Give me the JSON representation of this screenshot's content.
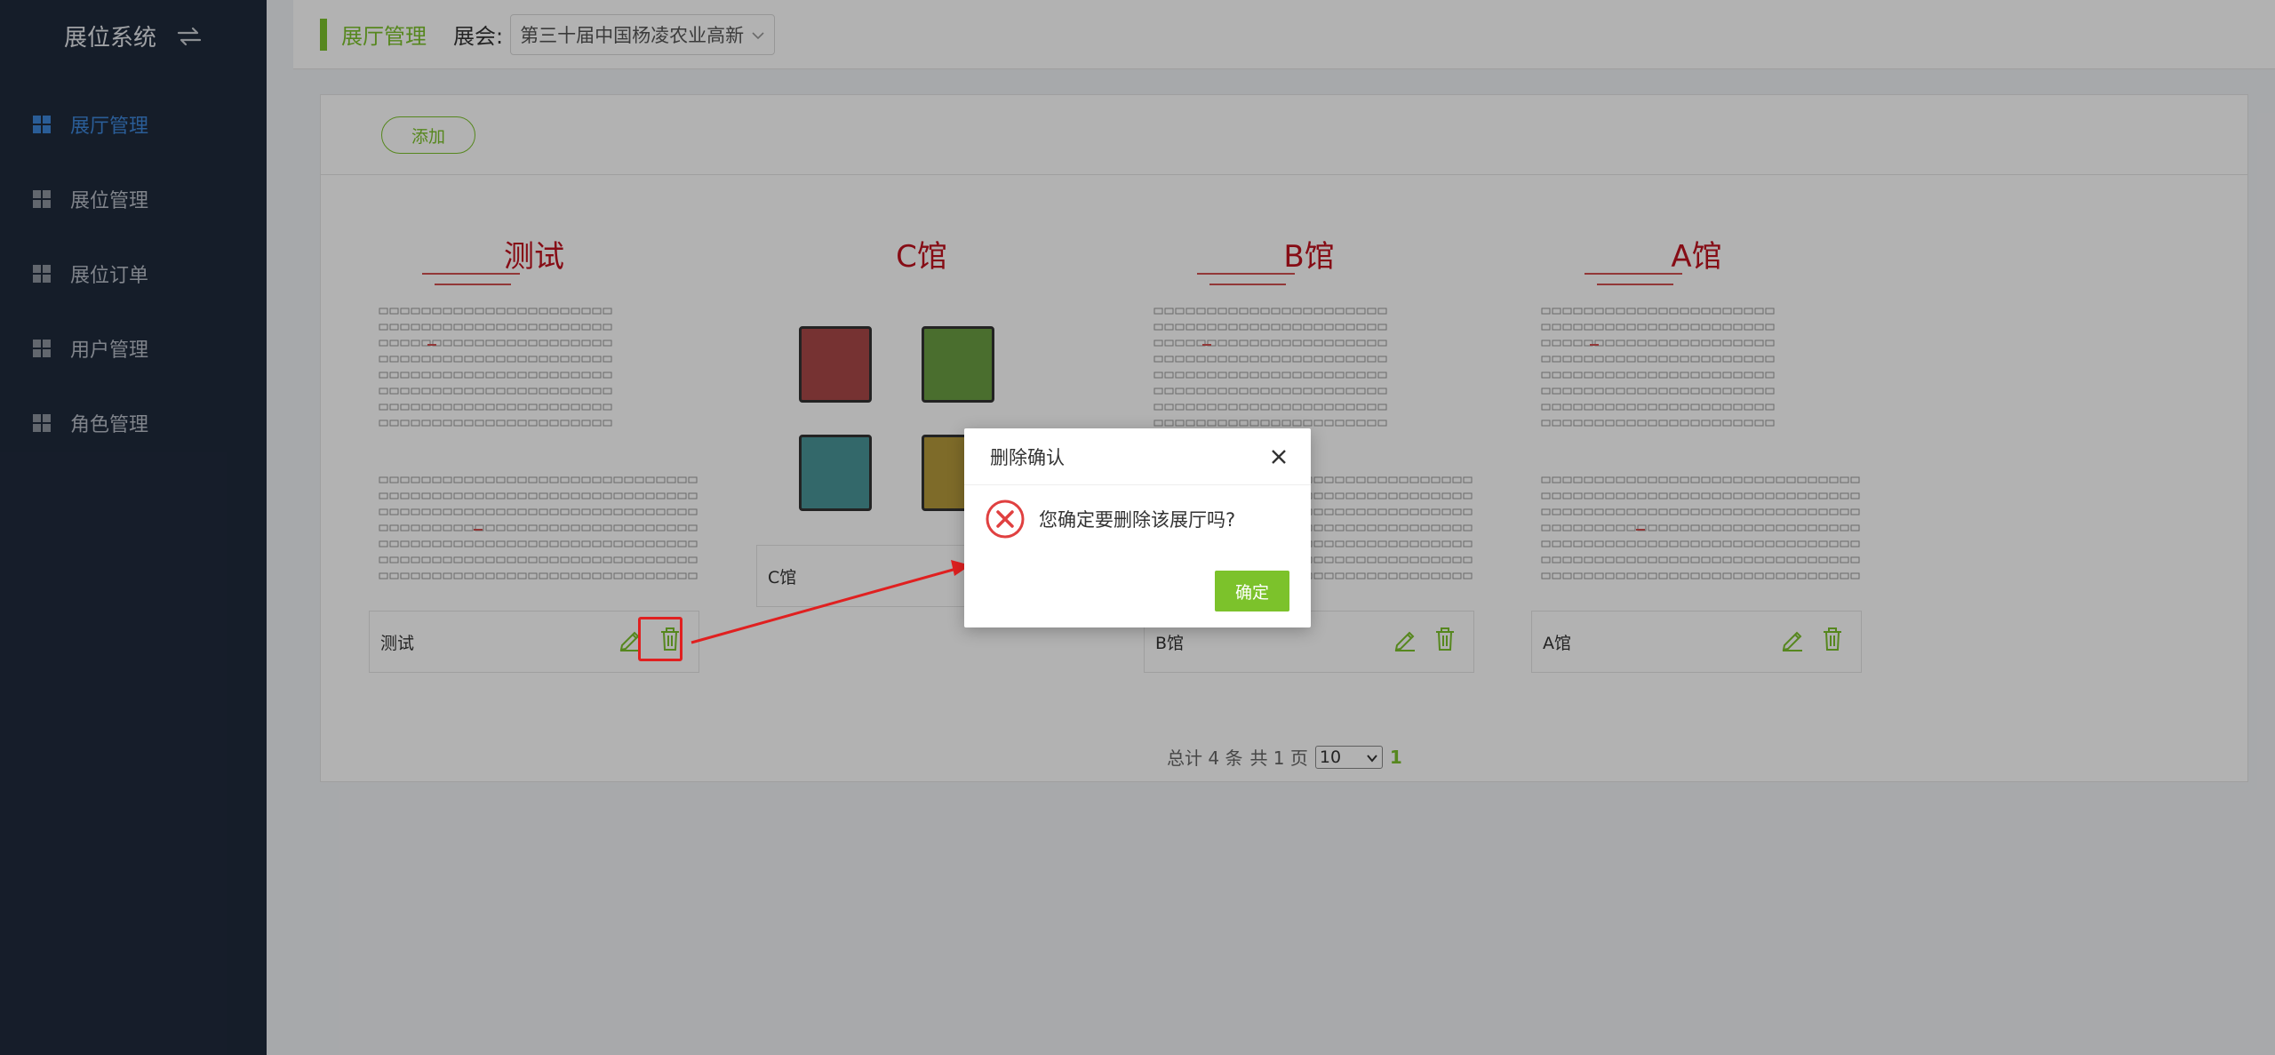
{
  "sidebar": {
    "brand": "展位系统",
    "items": [
      {
        "label": "展厅管理",
        "active": true
      },
      {
        "label": "展位管理"
      },
      {
        "label": "展位订单"
      },
      {
        "label": "用户管理"
      },
      {
        "label": "角色管理"
      }
    ]
  },
  "topbar": {
    "crumb": "展厅管理",
    "expo_label": "展会:",
    "expo_value": "第三十届中国杨凌农业高新"
  },
  "toolbar": {
    "add_label": "添加"
  },
  "halls": [
    {
      "title": "测试",
      "name": "测试",
      "thumb": "floorplan"
    },
    {
      "title": "C馆",
      "name": "C馆",
      "thumb": "colorblocks"
    },
    {
      "title": "B馆",
      "name": "B馆",
      "thumb": "floorplan"
    },
    {
      "title": "A馆",
      "name": "A馆",
      "thumb": "floorplan"
    }
  ],
  "pagination": {
    "total": "总计 4 条",
    "pages": "共 1 页",
    "page_size": "10",
    "current": "1"
  },
  "modal": {
    "title": "删除确认",
    "message": "您确定要删除该展厅吗?",
    "ok_label": "确定"
  },
  "colors": {
    "accent": "#7cc22b",
    "sidebar_bg": "#1f2a3c",
    "active_nav": "#3d86d8",
    "hall_title": "#c1121f",
    "highlight": "#e02020",
    "block_red": "#a94848",
    "block_green": "#6a9e42",
    "block_teal": "#4a9699",
    "block_yellow": "#b59a3c"
  }
}
